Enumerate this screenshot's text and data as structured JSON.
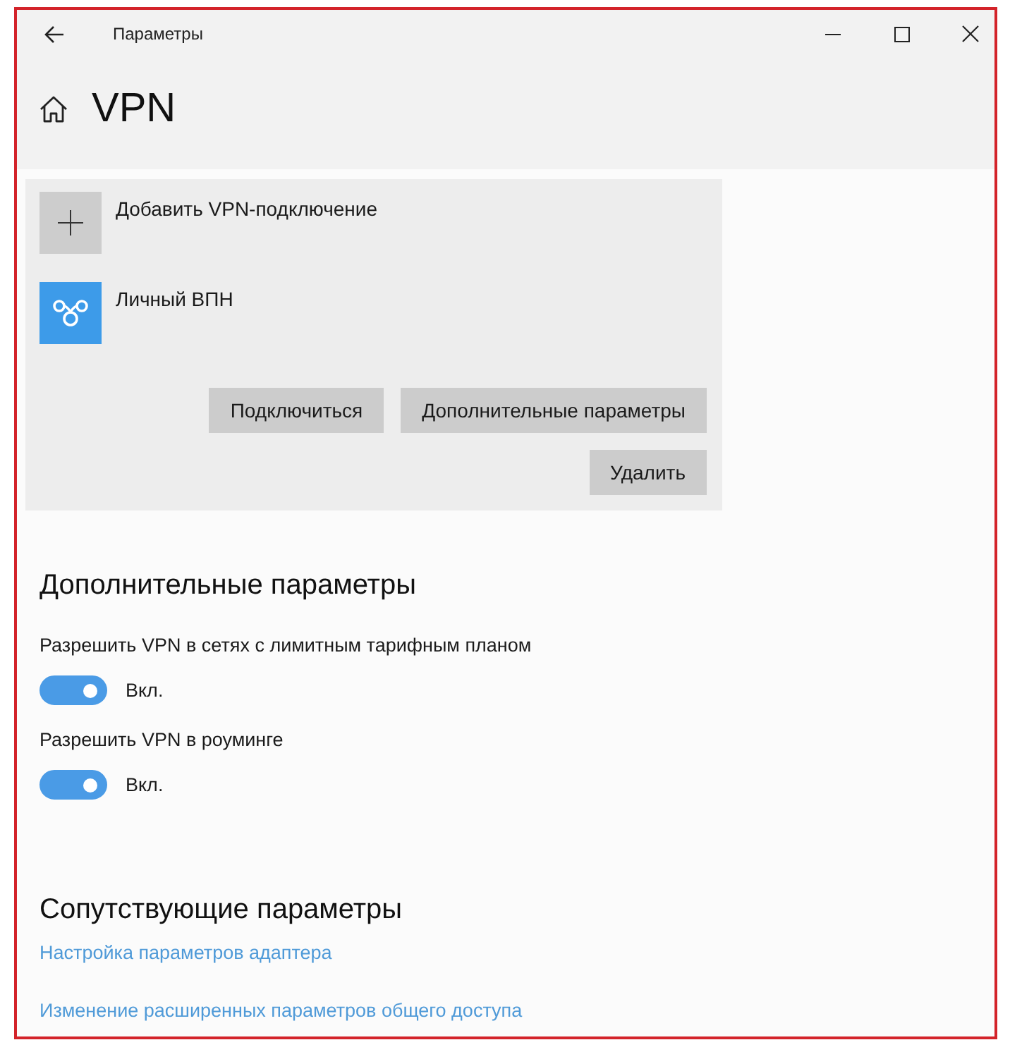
{
  "window": {
    "title": "Параметры"
  },
  "page": {
    "title": "VPN"
  },
  "vpn_list": {
    "add_item": {
      "label": "Добавить VPN-подключение"
    },
    "connections": [
      {
        "name": "Личный ВПН",
        "buttons": [
          {
            "label": "Подключиться"
          },
          {
            "label": "Дополнительные параметры"
          },
          {
            "label": "Удалить"
          }
        ]
      }
    ]
  },
  "advanced": {
    "title": "Дополнительные параметры",
    "settings": [
      {
        "label": "Разрешить VPN в сетях с лимитным тарифным планом",
        "on": true,
        "state_text": "Вкл."
      },
      {
        "label": "Разрешить VPN в роуминге",
        "on": true,
        "state_text": "Вкл."
      }
    ]
  },
  "related": {
    "title": "Сопутствующие параметры",
    "links": [
      "Настройка параметров адаптера",
      "Изменение расширенных параметров общего доступа"
    ]
  }
}
